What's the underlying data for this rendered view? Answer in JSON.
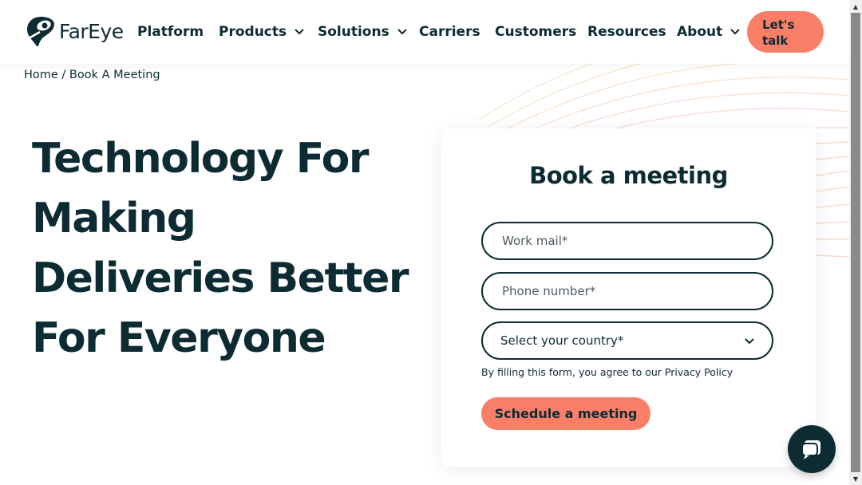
{
  "brand": {
    "name": "FarEye",
    "accent": "#fb7e69",
    "dark": "#0c2b33"
  },
  "nav": {
    "items": [
      {
        "label": "Platform",
        "dropdown": false
      },
      {
        "label": "Products",
        "dropdown": true
      },
      {
        "label": "Solutions",
        "dropdown": true
      },
      {
        "label": "Carriers",
        "dropdown": false
      },
      {
        "label": "Customers",
        "dropdown": false
      },
      {
        "label": "Resources",
        "dropdown": false
      },
      {
        "label": "About",
        "dropdown": true
      }
    ],
    "cta_line1": "Let's",
    "cta_line2": "talk"
  },
  "breadcrumb": "Home / Book A Meeting",
  "hero": {
    "line1": "Technology For",
    "line2": "Making",
    "line3": "Deliveries Better",
    "line4": "For Everyone"
  },
  "form": {
    "title": "Book a meeting",
    "email_placeholder": "Work mail*",
    "phone_placeholder": "Phone number*",
    "country_placeholder": "Select your country*",
    "policy_text": "By filling this form, you agree to our Privacy Policy",
    "submit_label": "Schedule a meeting"
  },
  "icons": {
    "logo": "fareye-pin-icon",
    "chevron": "chevron-down-icon",
    "chat": "chat-bubble-icon"
  }
}
